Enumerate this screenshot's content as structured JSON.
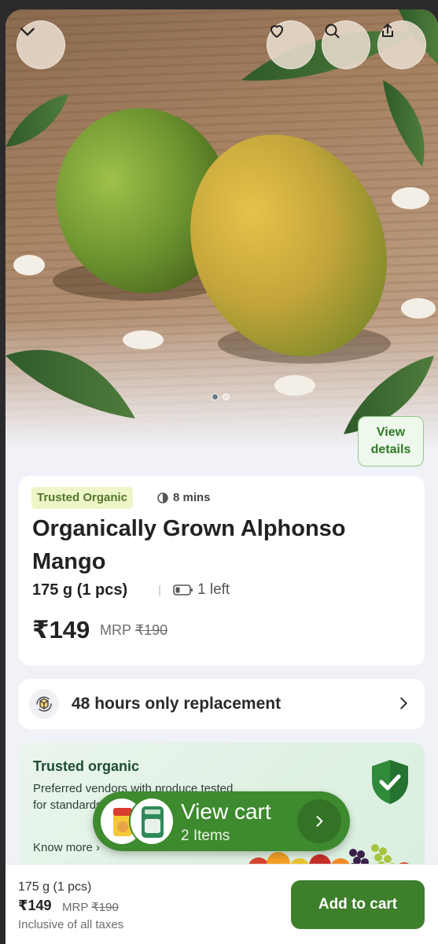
{
  "hero": {
    "images_count": 2,
    "active_image": 1,
    "view_details_line1": "View",
    "view_details_line2": "details"
  },
  "topbar": {
    "collapse_icon": "chevron-down-icon",
    "wishlist_icon": "heart-icon",
    "search_icon": "search-icon",
    "share_icon": "share-icon"
  },
  "product": {
    "tag": "Trusted Organic",
    "delivery_time": "8 mins",
    "title": "Organically Grown Alphonso Mango",
    "quantity": "175 g (1 pcs)",
    "stock": "1 left",
    "price": "₹149",
    "mrp_label": "MRP",
    "mrp_value": "₹190"
  },
  "replacement": {
    "text": "48 hours only replacement"
  },
  "trusted": {
    "title": "Trusted organic",
    "description": "Preferred vendors with produce tested for standards",
    "link": "Know more"
  },
  "view_cart": {
    "title": "View cart",
    "subtitle": "2 Items"
  },
  "bottom_bar": {
    "quantity": "175 g (1 pcs)",
    "price": "₹149",
    "mrp_label": "MRP",
    "mrp_value": "₹190",
    "tax_note": "Inclusive of all taxes",
    "add_button": "Add to cart"
  },
  "colors": {
    "primary_green": "#3d7f2b",
    "tag_bg": "#eef6c8",
    "page_bg": "#f1f2f7"
  }
}
